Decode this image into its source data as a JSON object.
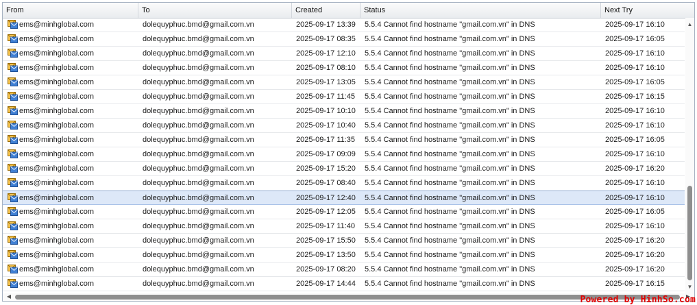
{
  "columns": {
    "from": "From",
    "to": "To",
    "created": "Created",
    "status": "Status",
    "next_try": "Next Try"
  },
  "row_icon": "mail-envelope-icon",
  "selected_row_index": 12,
  "rows": [
    {
      "from": "ems@minhglobal.com",
      "to": "dolequyphuc.bmd@gmail.com.vn",
      "created": "2025-09-17 13:39",
      "status": "5.5.4 Cannot find hostname \"gmail.com.vn\" in DNS",
      "next_try": "2025-09-17 16:10"
    },
    {
      "from": "ems@minhglobal.com",
      "to": "dolequyphuc.bmd@gmail.com.vn",
      "created": "2025-09-17 08:35",
      "status": "5.5.4 Cannot find hostname \"gmail.com.vn\" in DNS",
      "next_try": "2025-09-17 16:05"
    },
    {
      "from": "ems@minhglobal.com",
      "to": "dolequyphuc.bmd@gmail.com.vn",
      "created": "2025-09-17 12:10",
      "status": "5.5.4 Cannot find hostname \"gmail.com.vn\" in DNS",
      "next_try": "2025-09-17 16:10"
    },
    {
      "from": "ems@minhglobal.com",
      "to": "dolequyphuc.bmd@gmail.com.vn",
      "created": "2025-09-17 08:10",
      "status": "5.5.4 Cannot find hostname \"gmail.com.vn\" in DNS",
      "next_try": "2025-09-17 16:10"
    },
    {
      "from": "ems@minhglobal.com",
      "to": "dolequyphuc.bmd@gmail.com.vn",
      "created": "2025-09-17 13:05",
      "status": "5.5.4 Cannot find hostname \"gmail.com.vn\" in DNS",
      "next_try": "2025-09-17 16:05"
    },
    {
      "from": "ems@minhglobal.com",
      "to": "dolequyphuc.bmd@gmail.com.vn",
      "created": "2025-09-17 11:45",
      "status": "5.5.4 Cannot find hostname \"gmail.com.vn\" in DNS",
      "next_try": "2025-09-17 16:15"
    },
    {
      "from": "ems@minhglobal.com",
      "to": "dolequyphuc.bmd@gmail.com.vn",
      "created": "2025-09-17 10:10",
      "status": "5.5.4 Cannot find hostname \"gmail.com.vn\" in DNS",
      "next_try": "2025-09-17 16:10"
    },
    {
      "from": "ems@minhglobal.com",
      "to": "dolequyphuc.bmd@gmail.com.vn",
      "created": "2025-09-17 10:40",
      "status": "5.5.4 Cannot find hostname \"gmail.com.vn\" in DNS",
      "next_try": "2025-09-17 16:10"
    },
    {
      "from": "ems@minhglobal.com",
      "to": "dolequyphuc.bmd@gmail.com.vn",
      "created": "2025-09-17 11:35",
      "status": "5.5.4 Cannot find hostname \"gmail.com.vn\" in DNS",
      "next_try": "2025-09-17 16:05"
    },
    {
      "from": "ems@minhglobal.com",
      "to": "dolequyphuc.bmd@gmail.com.vn",
      "created": "2025-09-17 09:09",
      "status": "5.5.4 Cannot find hostname \"gmail.com.vn\" in DNS",
      "next_try": "2025-09-17 16:10"
    },
    {
      "from": "ems@minhglobal.com",
      "to": "dolequyphuc.bmd@gmail.com.vn",
      "created": "2025-09-17 15:20",
      "status": "5.5.4 Cannot find hostname \"gmail.com.vn\" in DNS",
      "next_try": "2025-09-17 16:20"
    },
    {
      "from": "ems@minhglobal.com",
      "to": "dolequyphuc.bmd@gmail.com.vn",
      "created": "2025-09-17 08:40",
      "status": "5.5.4 Cannot find hostname \"gmail.com.vn\" in DNS",
      "next_try": "2025-09-17 16:10"
    },
    {
      "from": "ems@minhglobal.com",
      "to": "dolequyphuc.bmd@gmail.com.vn",
      "created": "2025-09-17 12:40",
      "status": "5.5.4 Cannot find hostname \"gmail.com.vn\" in DNS",
      "next_try": "2025-09-17 16:10"
    },
    {
      "from": "ems@minhglobal.com",
      "to": "dolequyphuc.bmd@gmail.com.vn",
      "created": "2025-09-17 12:05",
      "status": "5.5.4 Cannot find hostname \"gmail.com.vn\" in DNS",
      "next_try": "2025-09-17 16:05"
    },
    {
      "from": "ems@minhglobal.com",
      "to": "dolequyphuc.bmd@gmail.com.vn",
      "created": "2025-09-17 11:40",
      "status": "5.5.4 Cannot find hostname \"gmail.com.vn\" in DNS",
      "next_try": "2025-09-17 16:10"
    },
    {
      "from": "ems@minhglobal.com",
      "to": "dolequyphuc.bmd@gmail.com.vn",
      "created": "2025-09-17 15:50",
      "status": "5.5.4 Cannot find hostname \"gmail.com.vn\" in DNS",
      "next_try": "2025-09-17 16:20"
    },
    {
      "from": "ems@minhglobal.com",
      "to": "dolequyphuc.bmd@gmail.com.vn",
      "created": "2025-09-17 13:50",
      "status": "5.5.4 Cannot find hostname \"gmail.com.vn\" in DNS",
      "next_try": "2025-09-17 16:20"
    },
    {
      "from": "ems@minhglobal.com",
      "to": "dolequyphuc.bmd@gmail.com.vn",
      "created": "2025-09-17 08:20",
      "status": "5.5.4 Cannot find hostname \"gmail.com.vn\" in DNS",
      "next_try": "2025-09-17 16:20"
    },
    {
      "from": "ems@minhglobal.com",
      "to": "dolequyphuc.bmd@gmail.com.vn",
      "created": "2025-09-17 14:44",
      "status": "5.5.4 Cannot find hostname \"gmail.com.vn\" in DNS",
      "next_try": "2025-09-17 16:15"
    }
  ],
  "watermark": "Powered by HinhSo.com",
  "colors": {
    "selected_row": "#dde8f8",
    "header_bg": "#e9ecef",
    "scroll_thumb": "#8e8e8e",
    "watermark": "#e10000"
  }
}
